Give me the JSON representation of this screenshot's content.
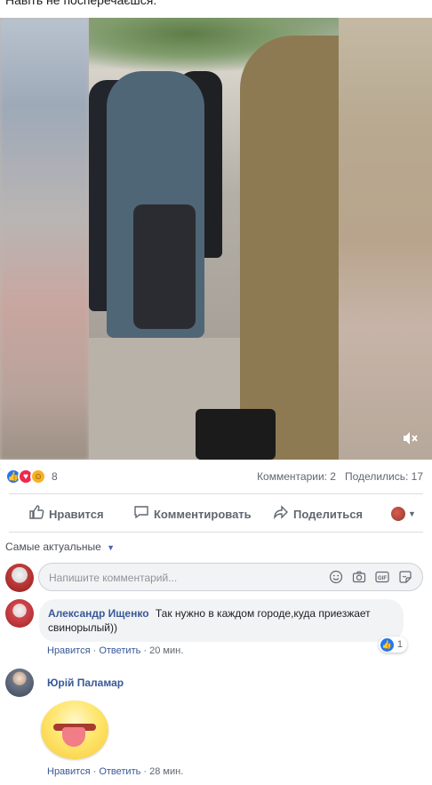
{
  "post": {
    "text": "Навіть не посперечаєшся."
  },
  "video": {
    "mute_icon": "speaker-muted-icon"
  },
  "stats": {
    "reactions": [
      "like",
      "love",
      "haha"
    ],
    "reaction_count": "8",
    "comments": "Комментарии: 2",
    "shares": "Поделились: 17"
  },
  "actions": {
    "like": "Нравится",
    "comment": "Комментировать",
    "share": "Поделиться"
  },
  "sort": {
    "label": "Самые актуальные"
  },
  "composer": {
    "placeholder": "Напишите комментарий..."
  },
  "comments": [
    {
      "author": "Александр Ищенко",
      "text": "Так нужно в каждом городе,куда приезжает свинорылый))",
      "likes": "1",
      "like_label": "Нравится",
      "reply_label": "Ответить",
      "time": "20 мин."
    },
    {
      "author": "Юрій Паламар",
      "sticker": "tongue-out-emoji",
      "like_label": "Нравится",
      "reply_label": "Ответить",
      "time": "28 мин."
    }
  ],
  "colors": {
    "link": "#385898",
    "like_blue": "#2078f4",
    "love_red": "#f0284a",
    "haha_yellow": "#f7b125"
  }
}
